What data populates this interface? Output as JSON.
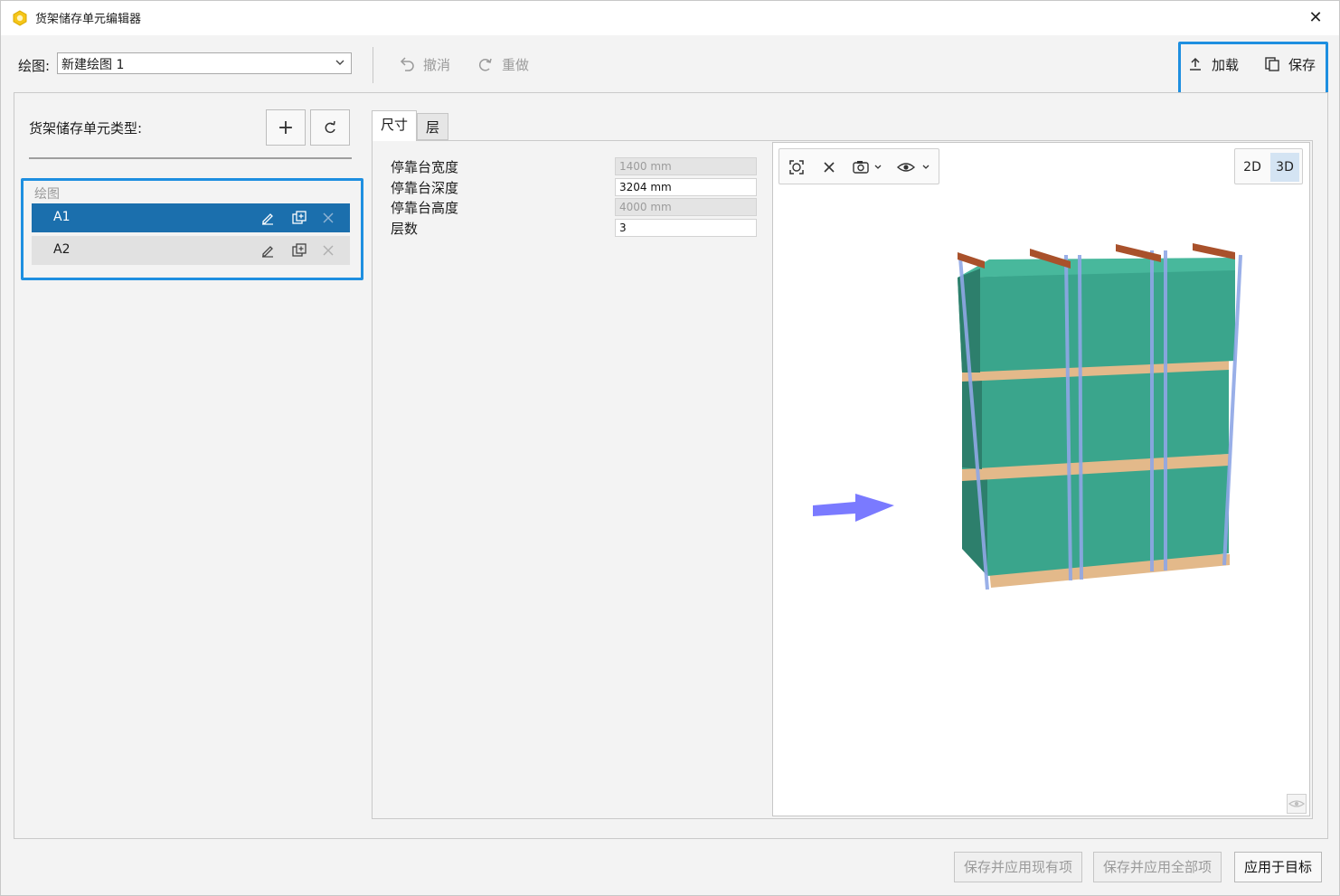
{
  "window": {
    "title": "货架储存单元编辑器",
    "close_label": "✕"
  },
  "toolbar": {
    "drawing_label": "绘图:",
    "drawing_value": "新建绘图 1",
    "undo_label": "撤消",
    "redo_label": "重做",
    "load_label": "加载",
    "save_label": "保存"
  },
  "left_panel": {
    "types_label": "货架储存单元类型:",
    "add_label": "+",
    "group_label": "绘图",
    "items": [
      {
        "label": "A1",
        "selected": true
      },
      {
        "label": "A2",
        "selected": false
      }
    ]
  },
  "tabs": [
    {
      "label": "尺寸",
      "active": true
    },
    {
      "label": "层",
      "active": false
    }
  ],
  "properties": [
    {
      "label": "停靠台宽度",
      "value": "1400 mm",
      "enabled": false
    },
    {
      "label": "停靠台深度",
      "value": "3204 mm",
      "enabled": true
    },
    {
      "label": "停靠台高度",
      "value": "4000 mm",
      "enabled": false
    },
    {
      "label": "层数",
      "value": "3",
      "enabled": true
    }
  ],
  "viewer": {
    "toggle_2d": "2D",
    "toggle_3d": "3D",
    "active_mode": "3D",
    "icons": [
      "zoom-fit-icon",
      "close-icon",
      "camera-icon",
      "eye-icon"
    ]
  },
  "footer": {
    "save_apply_existing": "保存并应用现有项",
    "save_apply_all": "保存并应用全部项",
    "apply_to_target": "应用于目标"
  },
  "colors": {
    "accent": "#1e8fe0",
    "selected_row": "#1b6fad",
    "box_green": "#3aa58c",
    "pallet_wood": "#e3b98a",
    "beam_orange": "#a9512b",
    "arrow": "#7a7aff"
  }
}
